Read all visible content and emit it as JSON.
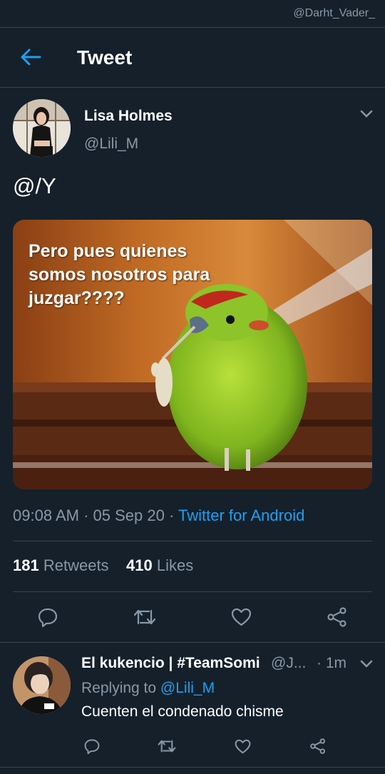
{
  "watermark": "@Darht_Vader_",
  "header": {
    "title": "Tweet",
    "back_icon": "arrow-left-icon"
  },
  "tweet": {
    "author_name": "Lisa Holmes",
    "author_handle": "@Lili_M",
    "text": "@/Y",
    "media_caption": "Pero pues quienes somos nosotros para juzgar????",
    "time": "09:08 AM",
    "date": "05 Sep 20",
    "source": "Twitter for Android",
    "retweets_count": "181",
    "retweets_label": "Retweets",
    "likes_count": "410",
    "likes_label": "Likes",
    "actions": [
      "reply-icon",
      "retweet-icon",
      "like-icon",
      "share-icon"
    ]
  },
  "reply": {
    "author_name": "El kukencio | #TeamSomi",
    "author_handle": "@J...",
    "time": "· 1m",
    "replying_prefix": "Replying to ",
    "replying_to": "@Lili_M",
    "text": "Cuenten el condenado chisme"
  },
  "colors": {
    "background": "#15202b",
    "divider": "#38444d",
    "secondary_text": "#8899a6",
    "accent": "#1da1f2"
  }
}
